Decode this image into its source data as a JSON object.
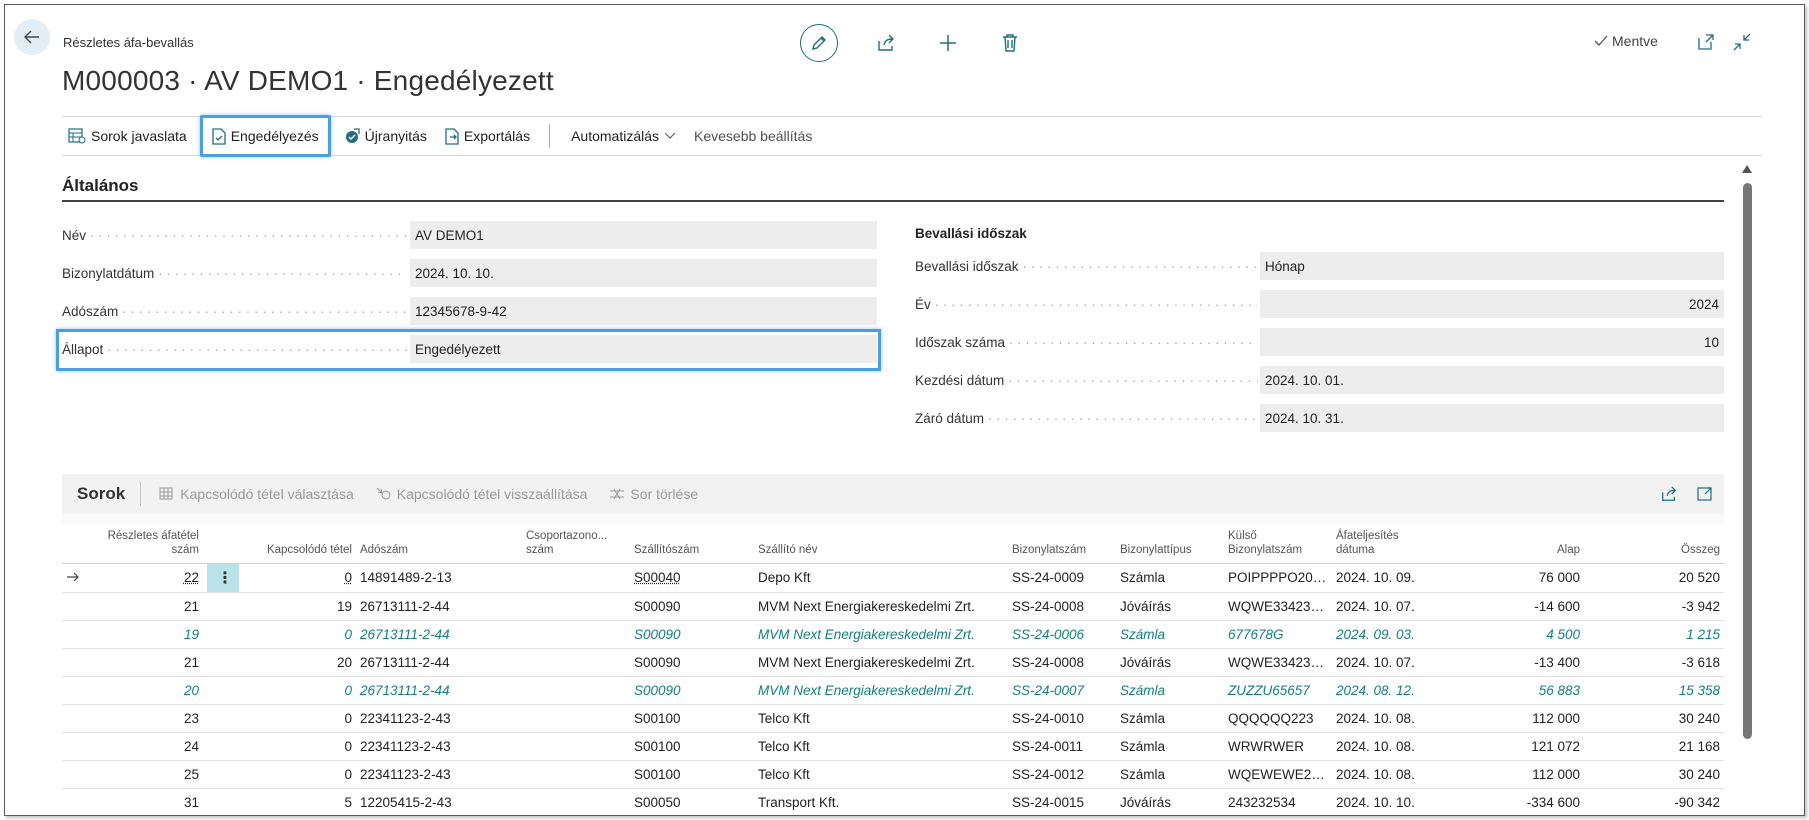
{
  "header": {
    "breadcrumb": "Részletes áfa-bevallás",
    "title": "M000003 · AV DEMO1 · Engedélyezett",
    "saved": "Mentve"
  },
  "actions": {
    "suggest_lines": "Sorok javaslata",
    "release": "Engedélyezés",
    "reopen": "Újranyitás",
    "export": "Exportálás",
    "automate": "Automatizálás",
    "fewer_options": "Kevesebb beállítás"
  },
  "general": {
    "title": "Általános",
    "fields": [
      {
        "label": "Név",
        "value": "AV DEMO1"
      },
      {
        "label": "Bizonylatdátum",
        "value": "2024. 10. 10."
      },
      {
        "label": "Adószám",
        "value": "12345678-9-42"
      },
      {
        "label": "Állapot",
        "value": "Engedélyezett"
      }
    ],
    "period_title": "Bevallási időszak",
    "period_fields": [
      {
        "label": "Bevallási időszak",
        "value": "Hónap"
      },
      {
        "label": "Év",
        "value": "2024"
      },
      {
        "label": "Időszak száma",
        "value": "10"
      },
      {
        "label": "Kezdési dátum",
        "value": "2024. 10. 01."
      },
      {
        "label": "Záró dátum",
        "value": "2024. 10. 31."
      }
    ]
  },
  "lines": {
    "title": "Sorok",
    "actions": {
      "select_related": "Kapcsolódó tétel választása",
      "restore_related": "Kapcsolódó tétel visszaállítása",
      "delete_line": "Sor törlése"
    },
    "columns": {
      "entry_no": "Részletes áfatétel szám",
      "related": "Kapcsolódó tétel",
      "vat_no": "Adószám",
      "group_no": "Csoportazono... szám",
      "vendor_no": "Szállítószám",
      "vendor_name": "Szállító név",
      "doc_no": "Bizonylatszám",
      "doc_type": "Bizonylattípus",
      "ext_doc_no": "Külső Bizonylatszám",
      "vat_date": "Áfateljesítés dátuma",
      "base": "Alap",
      "amount": "Összeg"
    },
    "rows": [
      {
        "entry": "22",
        "related": "0",
        "vat": "14891489-2-13",
        "group": "",
        "vendor": "S00040",
        "name": "Depo Kft",
        "doc": "SS-24-0009",
        "type": "Számla",
        "ext": "POIPPPPO200...",
        "date": "2024. 10. 09.",
        "base": "76 000",
        "amount": "20 520",
        "style": "current"
      },
      {
        "entry": "21",
        "related": "19",
        "vat": "26713111-2-44",
        "group": "",
        "vendor": "S00090",
        "name": "MVM Next Energiakereskedelmi Zrt.",
        "doc": "SS-24-0008",
        "type": "Jóváírás",
        "ext": "WQWE334234...",
        "date": "2024. 10. 07.",
        "base": "-14 600",
        "amount": "-3 942",
        "style": "normal"
      },
      {
        "entry": "19",
        "related": "0",
        "vat": "26713111-2-44",
        "group": "",
        "vendor": "S00090",
        "name": "MVM Next Energiakereskedelmi Zrt.",
        "doc": "SS-24-0006",
        "type": "Számla",
        "ext": "677678G",
        "date": "2024. 09. 03.",
        "base": "4 500",
        "amount": "1 215",
        "style": "teal"
      },
      {
        "entry": "21",
        "related": "20",
        "vat": "26713111-2-44",
        "group": "",
        "vendor": "S00090",
        "name": "MVM Next Energiakereskedelmi Zrt.",
        "doc": "SS-24-0008",
        "type": "Jóváírás",
        "ext": "WQWE334234...",
        "date": "2024. 10. 07.",
        "base": "-13 400",
        "amount": "-3 618",
        "style": "normal"
      },
      {
        "entry": "20",
        "related": "0",
        "vat": "26713111-2-44",
        "group": "",
        "vendor": "S00090",
        "name": "MVM Next Energiakereskedelmi Zrt.",
        "doc": "SS-24-0007",
        "type": "Számla",
        "ext": "ZUZZU65657",
        "date": "2024. 08. 12.",
        "base": "56 883",
        "amount": "15 358",
        "style": "teal"
      },
      {
        "entry": "23",
        "related": "0",
        "vat": "22341123-2-43",
        "group": "",
        "vendor": "S00100",
        "name": "Telco Kft",
        "doc": "SS-24-0010",
        "type": "Számla",
        "ext": "QQQQQQ223",
        "date": "2024. 10. 08.",
        "base": "112 000",
        "amount": "30 240",
        "style": "normal"
      },
      {
        "entry": "24",
        "related": "0",
        "vat": "22341123-2-43",
        "group": "",
        "vendor": "S00100",
        "name": "Telco Kft",
        "doc": "SS-24-0011",
        "type": "Számla",
        "ext": "WRWRWER",
        "date": "2024. 10. 08.",
        "base": "121 072",
        "amount": "21 168",
        "style": "normal"
      },
      {
        "entry": "25",
        "related": "0",
        "vat": "22341123-2-43",
        "group": "",
        "vendor": "S00100",
        "name": "Telco Kft",
        "doc": "SS-24-0012",
        "type": "Számla",
        "ext": "WQEWEWE23...",
        "date": "2024. 10. 08.",
        "base": "112 000",
        "amount": "30 240",
        "style": "normal"
      },
      {
        "entry": "31",
        "related": "5",
        "vat": "12205415-2-43",
        "group": "",
        "vendor": "S00050",
        "name": "Transport Kft.",
        "doc": "SS-24-0015",
        "type": "Jóváírás",
        "ext": "243232534",
        "date": "2024. 10. 10.",
        "base": "-334 600",
        "amount": "-90 342",
        "style": "normal"
      }
    ]
  },
  "colors": {
    "accent": "#1e6f80",
    "highlight_border": "#4a9fe0",
    "teal_text": "#14807e",
    "selected_cell": "#b9e3e8"
  }
}
